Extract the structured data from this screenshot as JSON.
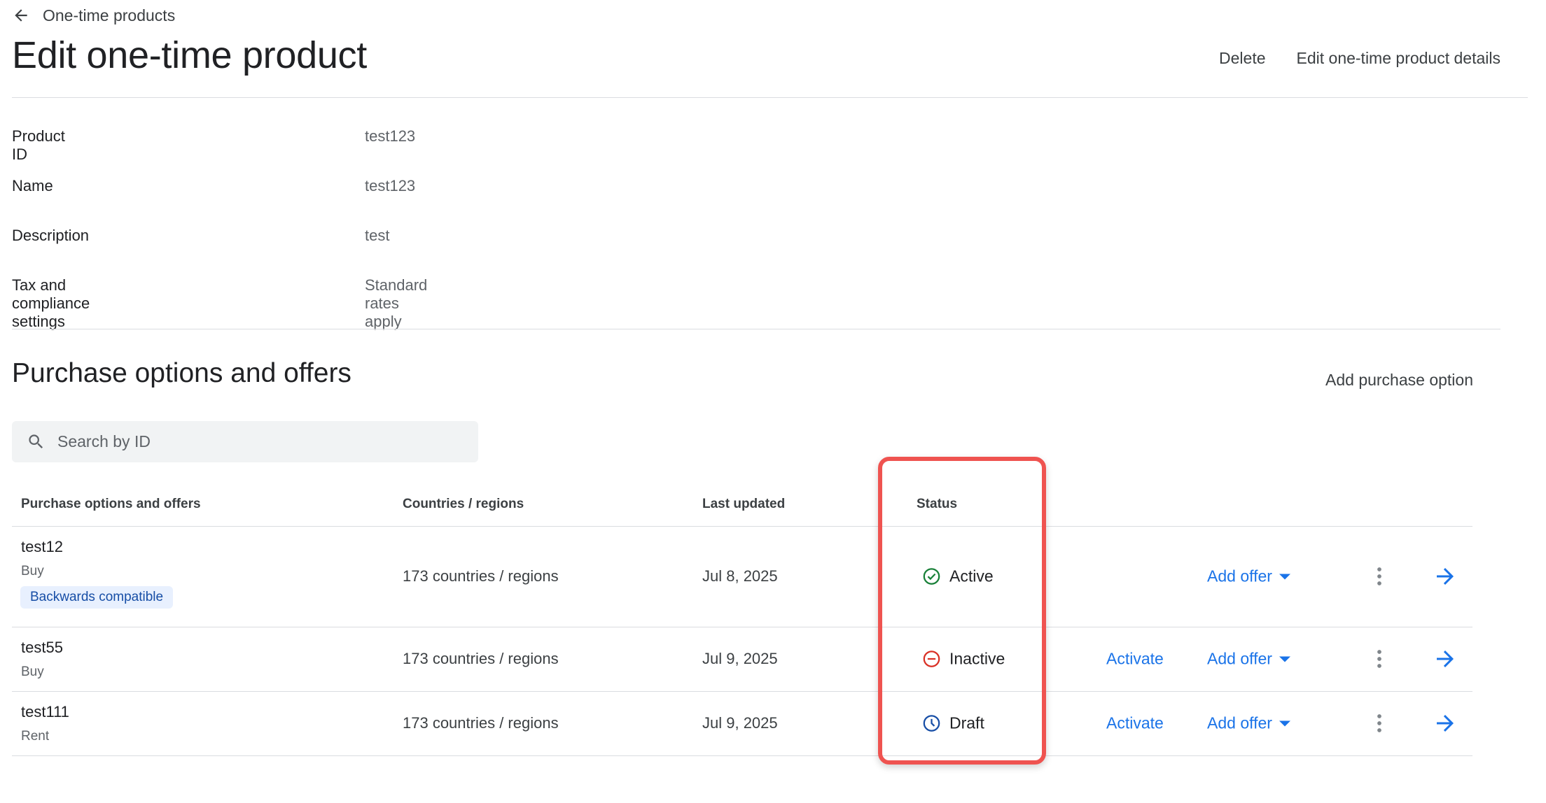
{
  "breadcrumb": {
    "back_label": "One-time products"
  },
  "page": {
    "title": "Edit one-time product"
  },
  "header_actions": {
    "delete_label": "Delete",
    "edit_label": "Edit one-time product details"
  },
  "details": [
    {
      "label": "Product ID",
      "value": "test123"
    },
    {
      "label": "Name",
      "value": "test123"
    },
    {
      "label": "Description",
      "value": "test"
    },
    {
      "label": "Tax and compliance settings",
      "value": "Standard rates apply"
    }
  ],
  "section": {
    "title": "Purchase options and offers",
    "add_label": "Add purchase option",
    "search_placeholder": "Search by ID"
  },
  "table": {
    "headers": {
      "options": "Purchase options and offers",
      "countries": "Countries / regions",
      "updated": "Last updated",
      "status": "Status"
    },
    "rows": [
      {
        "id": "test12",
        "type": "Buy",
        "badge": "Backwards compatible",
        "countries": "173 countries / regions",
        "updated": "Jul 8, 2025",
        "status": "Active",
        "status_icon": "check-circle-icon",
        "activate_label": "",
        "add_offer_label": "Add offer"
      },
      {
        "id": "test55",
        "type": "Buy",
        "badge": "",
        "countries": "173 countries / regions",
        "updated": "Jul 9, 2025",
        "status": "Inactive",
        "status_icon": "minus-circle-icon",
        "activate_label": "Activate",
        "add_offer_label": "Add offer"
      },
      {
        "id": "test111",
        "type": "Rent",
        "badge": "",
        "countries": "173 countries / regions",
        "updated": "Jul 9, 2025",
        "status": "Draft",
        "status_icon": "clock-icon",
        "activate_label": "Activate",
        "add_offer_label": "Add offer"
      }
    ]
  },
  "colors": {
    "link": "#1a73e8",
    "active": "#188038",
    "inactive": "#d93025",
    "draft": "#174ea6",
    "highlight": "#ef5350"
  }
}
